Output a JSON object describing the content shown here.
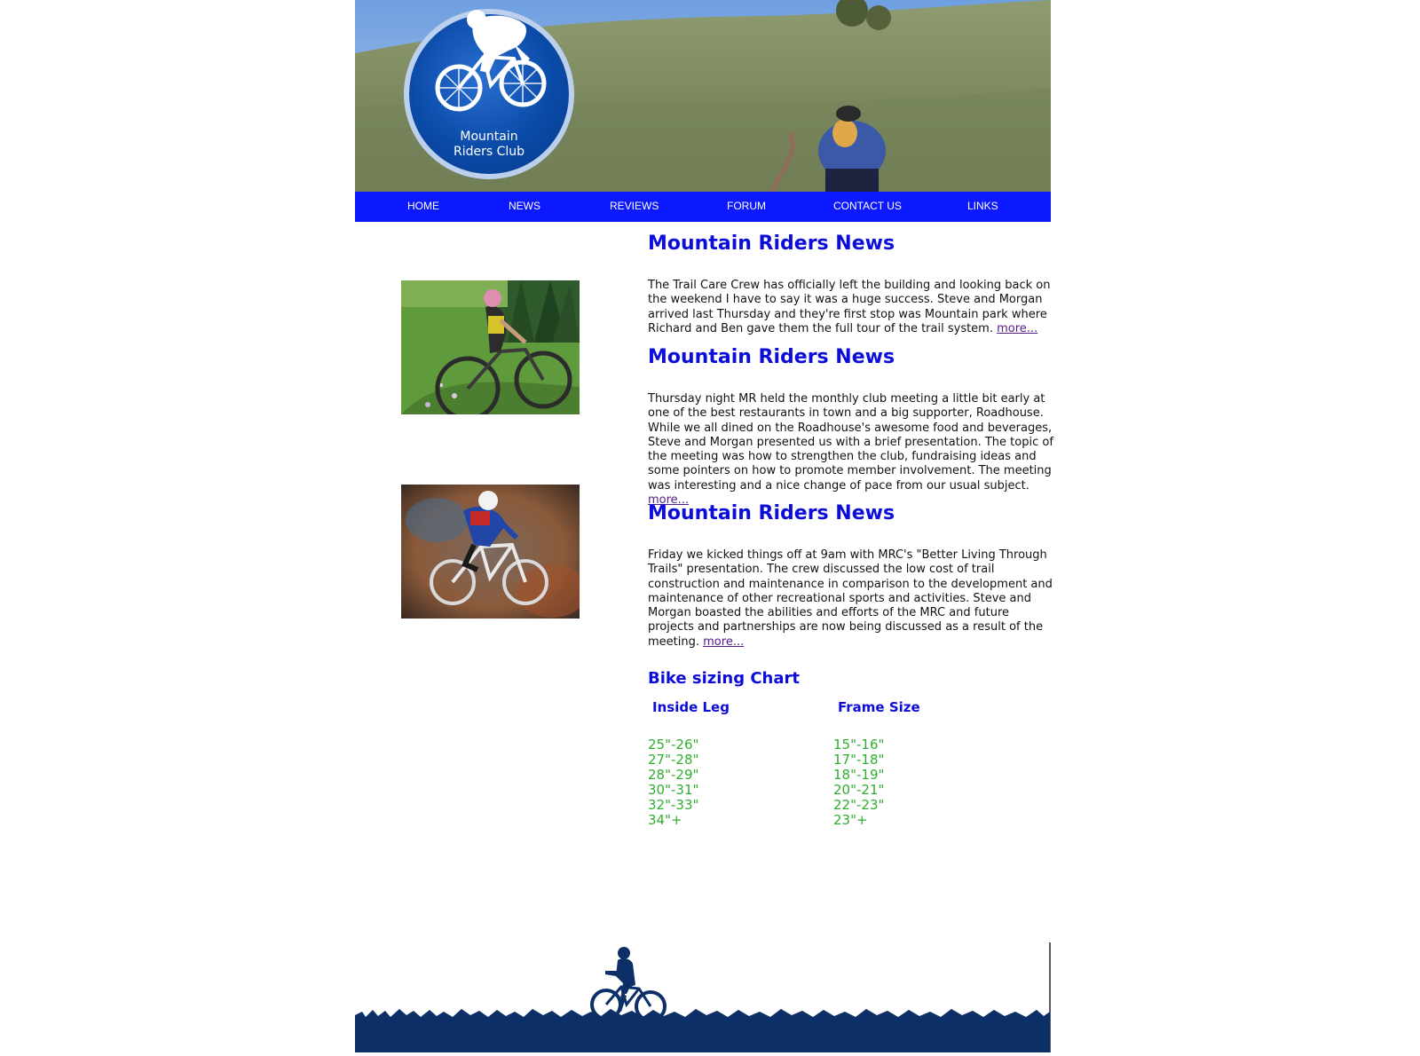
{
  "site": {
    "logo_text": "Mountain\nRiders Club"
  },
  "nav": {
    "items": [
      {
        "label": "HOME"
      },
      {
        "label": "NEWS"
      },
      {
        "label": "REVIEWS"
      },
      {
        "label": "FORUM"
      },
      {
        "label": "CONTACT US"
      },
      {
        "label": "LINKS"
      }
    ]
  },
  "news": [
    {
      "title": "Mountain Riders News",
      "body": "The Trail Care Crew has officially left the building and looking back on the weekend I have to say it was a huge success. Steve and Morgan arrived last Thursday and they're first stop was Mountain park where Richard and Ben gave them the full tour of the trail system.",
      "more": "more..."
    },
    {
      "title": "Mountain Riders News",
      "body": "Thursday night MR held the monthly club meeting a little bit early at one of the best restaurants in town and a big supporter, Roadhouse. While we all dined on the Roadhouse's awesome food and beverages, Steve and Morgan presented us with a brief presentation. The topic of the meeting was how to strengthen the club, fundraising ideas and some pointers on how to promote member involvement. The meeting was interesting and a nice change of pace from our usual subject.",
      "more": "more..."
    },
    {
      "title": "Mountain Riders News",
      "body": "Friday we kicked things off at 9am with MRC's \"Better Living Through Trails\" presentation. The crew discussed the low cost of trail construction and maintenance in comparison to the development and maintenance of other recreational sports and activities. Steve and Morgan boasted the abilities and efforts of the MRC and future projects and partnerships are now being discussed as a result of the meeting.",
      "more": "more..."
    }
  ],
  "sizing": {
    "title": "Bike sizing Chart",
    "col1_header": "Inside Leg",
    "col2_header": "Frame Size",
    "rows": [
      {
        "leg": "25\"-26\"",
        "frame": "15\"-16\""
      },
      {
        "leg": "27\"-28\"",
        "frame": "17\"-18\""
      },
      {
        "leg": "28\"-29\"",
        "frame": "18\"-19\""
      },
      {
        "leg": "30\"-31\"",
        "frame": "20\"-21\""
      },
      {
        "leg": "32\"-33\"",
        "frame": "22\"-23\""
      },
      {
        "leg": "34\"+",
        "frame": "23\"+"
      }
    ]
  },
  "colors": {
    "nav_bg": "#0c19ff",
    "heading": "#0d0ddb",
    "chart_values": "#2fae2f",
    "footer_silhouette": "#0b2f66"
  }
}
